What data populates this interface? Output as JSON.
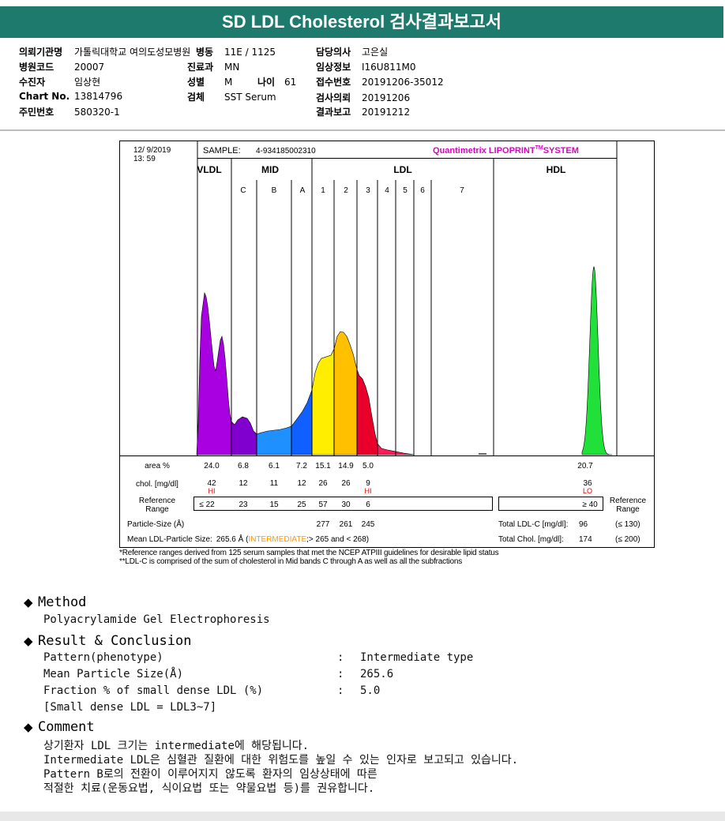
{
  "title": "SD LDL Cholesterol 검사결과보고서",
  "header": {
    "institution_label": "의뢰기관명",
    "institution": "가톨릭대학교 여의도성모병원",
    "ward_label": "병동",
    "ward": "11E / 1125",
    "doctor_label": "담당의사",
    "doctor": "고은실",
    "hospital_code_label": "병원코드",
    "hospital_code": "20007",
    "dept_label": "진료과",
    "dept": "MN",
    "clinical_label": "임상정보",
    "clinical": "I16U811M0",
    "patient_label": "수진자",
    "patient": "임상현",
    "sex_label": "성별",
    "sex": "M",
    "age_label": "나이",
    "age": "61",
    "receipt_label": "접수번호",
    "receipt": "20191206-35012",
    "chart_label": "Chart No.",
    "chart": "13814796",
    "specimen_label": "검체",
    "specimen": "SST Serum",
    "request_label": "검사의뢰",
    "request": "20191206",
    "id_label": "주민번호",
    "id": "580320-1",
    "report_label": "결과보고",
    "report": "20191212"
  },
  "chart_data": {
    "type": "area",
    "date": "12/ 9/2019",
    "time": "13: 59",
    "sample_label": "SAMPLE:",
    "sample_no": "4-934185002310",
    "system_prefix": "Quantimetrix LIPOPRINT",
    "system_sup": "TM",
    "system_suffix": "SYSTEM",
    "groups": [
      "VLDL",
      "MID",
      "LDL",
      "HDL"
    ],
    "bands": [
      "C",
      "B",
      "A",
      "1",
      "2",
      "3",
      "4",
      "5",
      "6",
      "7"
    ],
    "area_label": "area %",
    "area": {
      "VLDL": "24.0",
      "C": "6.8",
      "B": "6.1",
      "A": "7.2",
      "1": "15.1",
      "2": "14.9",
      "3": "5.0",
      "HDL": "20.7"
    },
    "chol_label": "chol. [mg/dl]",
    "chol": {
      "VLDL": "42",
      "C": "12",
      "B": "11",
      "A": "12",
      "1": "26",
      "2": "26",
      "3": "9",
      "HDL": "36"
    },
    "flags": {
      "VLDL": "HI",
      "3": "HI",
      "HDL": "LO"
    },
    "ref_label": "Reference Range",
    "ref": {
      "VLDL": "≤ 22",
      "C": "23",
      "B": "15",
      "A": "25",
      "1": "57",
      "2": "30",
      "3": "6",
      "HDL": "≥ 40"
    },
    "particle_label": "Particle-Size (Å)",
    "particle": {
      "1": "277",
      "2": "261",
      "3": "245"
    },
    "mean_label": "Mean LDL-Particle Size:",
    "mean_value": "265.6 Å",
    "mean_class": "INTERMEDIATE",
    "mean_range": ";> 265 and < 268)",
    "total_ldl_label": "Total LDL-C [mg/dl]:",
    "total_ldl": "96",
    "total_ldl_ref": "(≤ 130)",
    "total_chol_label": "Total Chol. [mg/dl]:",
    "total_chol": "174",
    "total_chol_ref": "(≤ 200)",
    "colors": {
      "VLDL": "#a800e0",
      "C": "#8000d0",
      "B": "#1e90ff",
      "A": "#1060ff",
      "1": "#ffee00",
      "2": "#ffc000",
      "3": "#e8002a",
      "tail": "#ff1a5a",
      "HDL": "#22e03a"
    }
  },
  "notes": [
    "*Reference ranges derived from 125 serum samples that met the NCEP ATPIII guidelines for desirable lipid status",
    "**LDL-C is comprised of the sum of cholesterol in Mid bands C through A as well as all the subfractions"
  ],
  "method": {
    "title": "Method",
    "text": "Polyacrylamide Gel Electrophoresis"
  },
  "result": {
    "title": "Result & Conclusion",
    "rows": [
      {
        "label": "Pattern(phenotype)",
        "value": "Intermediate type"
      },
      {
        "label": "Mean Particle Size(Å)",
        "value": "265.6"
      },
      {
        "label": "Fraction % of small dense LDL (%)",
        "value": "5.0"
      }
    ],
    "colon": ":",
    "note": "[Small dense LDL = LDL3~7]"
  },
  "comment": {
    "title": "Comment",
    "lines": [
      "상기환자 LDL 크기는 intermediate에 해당됩니다.",
      "Intermediate LDL은 심혈관 질환에 대한 위험도를 높일 수 있는 인자로 보고되고 있습니다.",
      "Pattern B로의 전환이 이루어지지 않도록 환자의 임상상태에 따른",
      "적절한 치료(운동요법, 식이요법 또는 약물요법 등)를 권유합니다."
    ]
  },
  "icons": {
    "bullet": "diamond-bullet-icon"
  }
}
